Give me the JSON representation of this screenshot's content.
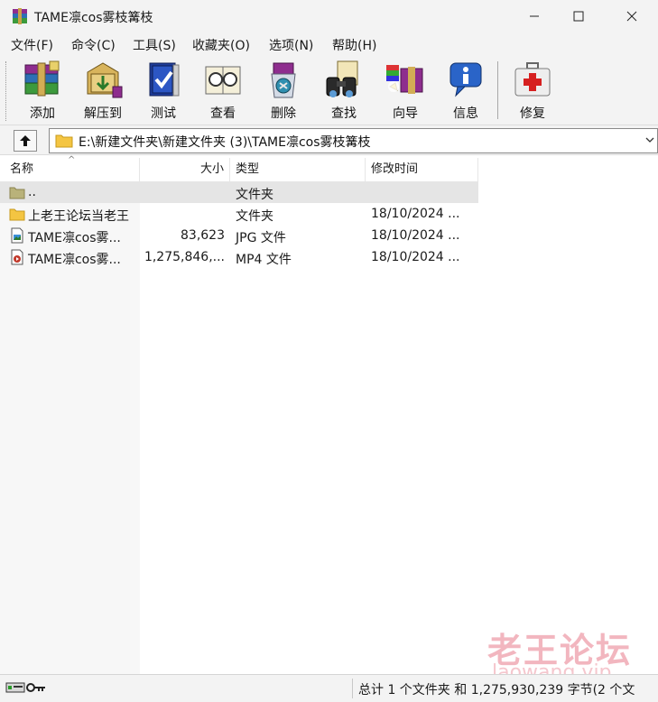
{
  "window": {
    "title": "TAME凛cos雾枝篝枝"
  },
  "menu": [
    "文件(F)",
    "命令(C)",
    "工具(S)",
    "收藏夹(O)",
    "选项(N)",
    "帮助(H)"
  ],
  "toolbar": [
    {
      "label": "添加",
      "icon": "add-archive-icon"
    },
    {
      "label": "解压到",
      "icon": "extract-icon"
    },
    {
      "label": "测试",
      "icon": "test-icon"
    },
    {
      "label": "查看",
      "icon": "view-icon"
    },
    {
      "label": "删除",
      "icon": "delete-icon"
    },
    {
      "label": "查找",
      "icon": "find-icon"
    },
    {
      "label": "向导",
      "icon": "wizard-icon"
    },
    {
      "label": "信息",
      "icon": "info-icon"
    },
    {
      "label": "修复",
      "icon": "repair-icon"
    }
  ],
  "address": {
    "path": "E:\\新建文件夹\\新建文件夹 (3)\\TAME凛cos雾枝篝枝"
  },
  "columns": {
    "name": "名称",
    "size": "大小",
    "type": "类型",
    "modified": "修改时间"
  },
  "files": [
    {
      "name": "..",
      "size": "",
      "type": "文件夹",
      "modified": "",
      "icon": "parent-folder-icon"
    },
    {
      "name": "上老王论坛当老王",
      "size": "",
      "type": "文件夹",
      "modified": "18/10/2024 ...",
      "icon": "folder-icon"
    },
    {
      "name": "TAME凛cos雾...",
      "size": "83,623",
      "type": "JPG 文件",
      "modified": "18/10/2024 ...",
      "icon": "image-file-icon"
    },
    {
      "name": "TAME凛cos雾...",
      "size": "1,275,846,...",
      "type": "MP4 文件",
      "modified": "18/10/2024 ...",
      "icon": "video-file-icon"
    }
  ],
  "watermark": {
    "main": "老王论坛",
    "sub": "laowang.vip"
  },
  "status": {
    "summary": "总计 1 个文件夹 和 1,275,930,239 字节(2 个文"
  },
  "colors": {
    "chrome": "#f3f3f3",
    "selected_row": "#e5e5e5",
    "folder": "#f4c542",
    "watermark": "#f2b6bf"
  }
}
